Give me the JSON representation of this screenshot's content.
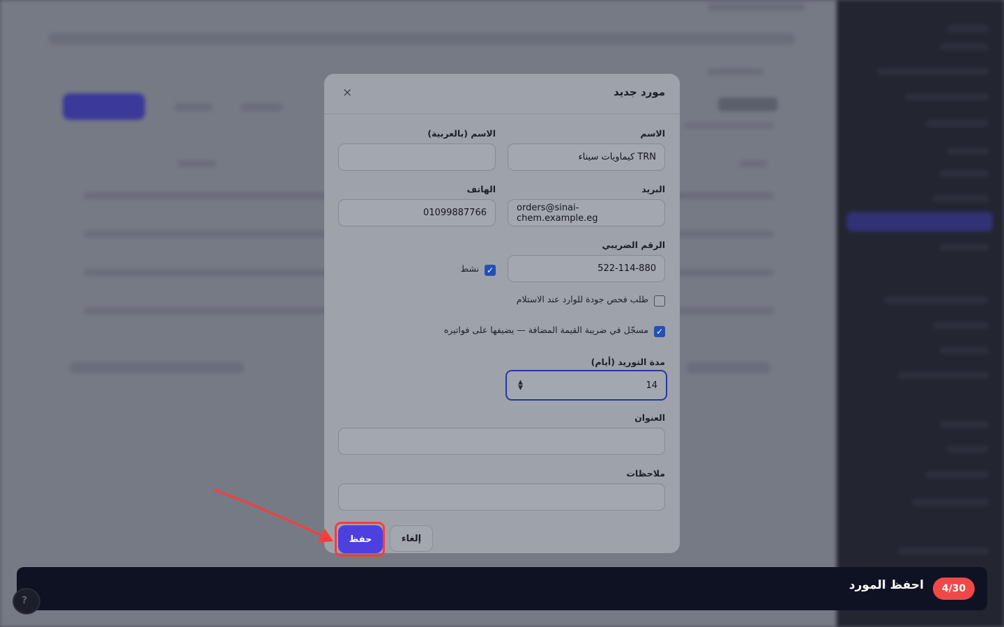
{
  "modal": {
    "title": "مورد جديد",
    "close_icon": "×",
    "fields": {
      "name": {
        "label": "الاسم",
        "value": "TRN كيماويات سيناء"
      },
      "name_ar": {
        "label": "الاسم (بالعربية)",
        "value": ""
      },
      "email": {
        "label": "البريد",
        "value": "orders@sinai-chem.example.eg"
      },
      "phone": {
        "label": "الهاتف",
        "value": "01099887766"
      },
      "tax_id": {
        "label": "الرقم الضريبي",
        "value": "522-114-880"
      },
      "active": {
        "label": "نشط",
        "checked": true
      },
      "qc_required": {
        "label": "طلب فحص جودة للوارد عند الاستلام",
        "checked": false
      },
      "vat_registered": {
        "label": "مسجّل في ضريبة القيمة المضافة — يضيفها على فواتيره",
        "checked": true
      },
      "lead_time": {
        "label": "مدة التوريد (أيام)",
        "value": "14"
      },
      "address": {
        "label": "العنوان",
        "value": ""
      },
      "notes": {
        "label": "ملاحظات",
        "value": ""
      }
    },
    "buttons": {
      "save": "حفظ",
      "cancel": "إلغاء"
    }
  },
  "tour": {
    "step": "4/30",
    "instruction": "احفظ المورد"
  },
  "colors": {
    "primary": "#4d3fe0",
    "highlight": "#ff3b3b",
    "tour_badge": "#f04848",
    "tour_bg": "#0f1222"
  }
}
